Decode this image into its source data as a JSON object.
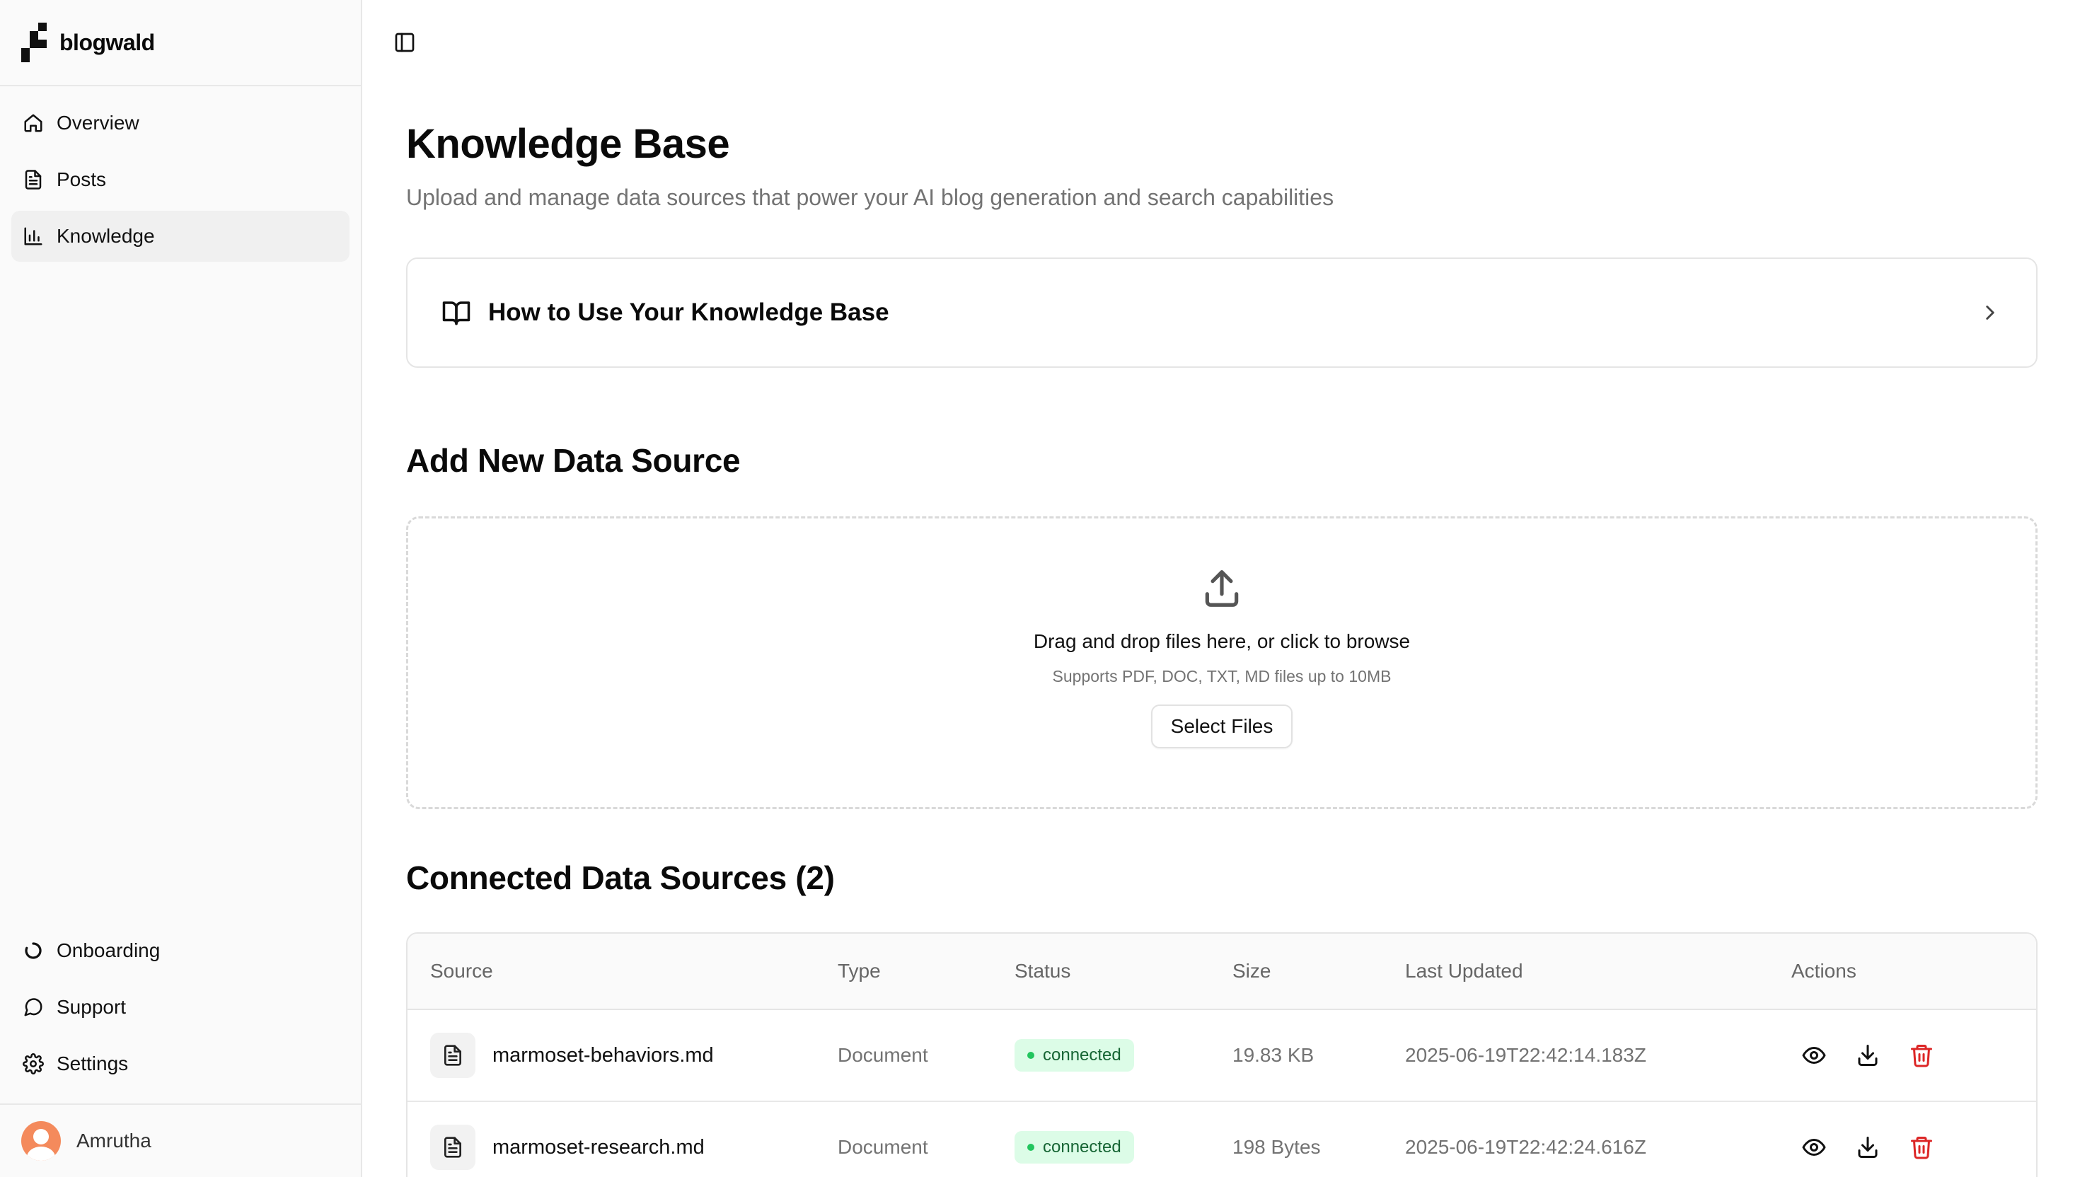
{
  "brand": {
    "name": "blogwald"
  },
  "sidebar": {
    "items": [
      {
        "label": "Overview",
        "icon": "home-icon"
      },
      {
        "label": "Posts",
        "icon": "file-text-icon"
      },
      {
        "label": "Knowledge",
        "icon": "bar-chart-icon",
        "active": true
      }
    ],
    "bottom_items": [
      {
        "label": "Onboarding",
        "icon": "loader-icon"
      },
      {
        "label": "Support",
        "icon": "message-circle-icon"
      },
      {
        "label": "Settings",
        "icon": "gear-icon"
      }
    ],
    "user": {
      "name": "Amrutha"
    }
  },
  "main": {
    "title": "Knowledge Base",
    "subtitle": "Upload and manage data sources that power your AI blog generation and search capabilities",
    "howto": {
      "title": "How to Use Your Knowledge Base"
    },
    "add": {
      "title": "Add New Data Source",
      "drop_text": "Drag and drop files here, or click to browse",
      "drop_hint": "Supports PDF, DOC, TXT, MD files up to 10MB",
      "select_label": "Select Files"
    },
    "connected": {
      "title": "Connected Data Sources (2)",
      "columns": [
        "Source",
        "Type",
        "Status",
        "Size",
        "Last Updated",
        "Actions"
      ],
      "rows": [
        {
          "source": "marmoset-behaviors.md",
          "type": "Document",
          "status": "connected",
          "size": "19.83 KB",
          "updated": "2025-06-19T22:42:14.183Z"
        },
        {
          "source": "marmoset-research.md",
          "type": "Document",
          "status": "connected",
          "size": "198 Bytes",
          "updated": "2025-06-19T22:42:24.616Z"
        }
      ]
    }
  },
  "colors": {
    "status_connected_bg": "#dcfce7",
    "status_connected_text": "#166534",
    "delete": "#dc2626"
  }
}
